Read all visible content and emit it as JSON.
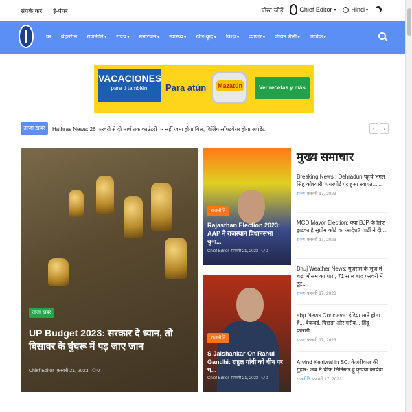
{
  "topbar": {
    "contact": "संपर्क करें",
    "epaper": "ई-पेपर",
    "post": "पोस्ट जोड़ें",
    "user": "Chief Editor",
    "language": "Hindi"
  },
  "nav": {
    "items": [
      "घर",
      "बेहतरीन",
      "राजनीति",
      "राज्य",
      "मनोरंजन",
      "स्वास्थ्य",
      "खेल-कूद",
      "विश्व",
      "व्यापार",
      "जीवन शैली",
      "अधिक"
    ]
  },
  "ad": {
    "brand_main": "VACACIONES",
    "brand_sub": "para ti también.",
    "middle": "Para atún",
    "product": "Mazatún",
    "cta": "Ver recetas y más"
  },
  "ticker": {
    "tag": "ताज़ा ख़बर",
    "text": "Hathras News: 26 फरवरी से दो मार्च तक काउंटरों पर नहीं जमा होगा बिल, बिलिंग सॉफ्टवेयर होगा अपडेट"
  },
  "featured": {
    "badge": "ताज़ा ख़बर",
    "title": "UP Budget 2023: सरकार दे ध्यान, तो बिसावर के घुंघरू में पड़ जाए जान",
    "author": "Chief Editor",
    "date": "फ़रवरी 21, 2023",
    "comments": "0"
  },
  "right_top": {
    "badge": "राजनीति",
    "title": "Rajasthan Election 2023: AAP ने राजस्थान विधानसभा चुना...",
    "author": "Chief Editor",
    "date": "फ़रवरी 21, 2023",
    "comments": "0"
  },
  "right_bottom": {
    "badge": "राजनीति",
    "title": "S Jaishankar On Rahul Gandhi: राहुल गांधी को चीन पर च...",
    "author": "Chief Editor",
    "date": "फ़रवरी 21, 2023",
    "comments": "0"
  },
  "sidebar": {
    "heading": "मुख्य समाचार",
    "items": [
      {
        "title": "Breaking News : Dehradun पहुंचे भगत सिंह कोश्यारी, एयरपोर्ट पर हुआ स्वागत......",
        "cat": "राज्य",
        "date": "फ़रवरी 17, 2023"
      },
      {
        "title": "MCD Mayor Election: क्या BJP के लिए झटका है सुप्रीम कोर्ट का आदेश? पार्टी ने दी ...",
        "cat": "राज्य",
        "date": "फ़रवरी 17, 2023"
      },
      {
        "title": "Bhuj Weather News: गुजरात के भुज में चढ़ा मौसम का पारा, 71 साल बाद फरवरी में टूट...",
        "cat": "राज्य",
        "date": "फ़रवरी 17, 2023"
      },
      {
        "title": "abp News Conclave: इंडिया माने होता है... बैकवर्ड, पिछड़ा और गरीब... हिंदू कारली...",
        "cat": "राज्य",
        "date": "फ़रवरी 17, 2023"
      },
      {
        "title": "Arvind Kejriwal in SC: केजरीवाल की गुहार- अब मैं चीफ मिनिस्टर हूं कृपया कार्यवा...",
        "cat": "राजनीति",
        "date": "फ़रवरी 17, 2023"
      }
    ]
  }
}
